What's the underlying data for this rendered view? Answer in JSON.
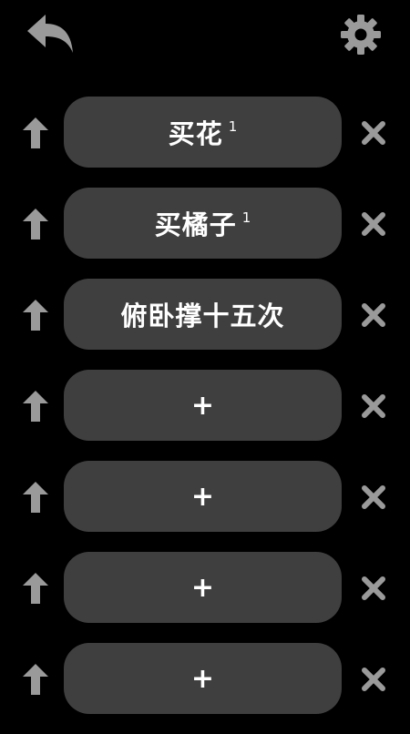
{
  "header": {
    "back_icon": "back-arrow-icon",
    "settings_icon": "gear-icon"
  },
  "tasks": [
    {
      "label": "买花",
      "count": "1"
    },
    {
      "label": "买橘子",
      "count": "1"
    },
    {
      "label": "俯卧撑十五次",
      "count": ""
    },
    {
      "label": "+",
      "count": ""
    },
    {
      "label": "+",
      "count": ""
    },
    {
      "label": "+",
      "count": ""
    },
    {
      "label": "+",
      "count": ""
    }
  ],
  "colors": {
    "background": "#000000",
    "pill": "#3f3f3f",
    "icon": "#9a9a9a",
    "text": "#ffffff"
  }
}
